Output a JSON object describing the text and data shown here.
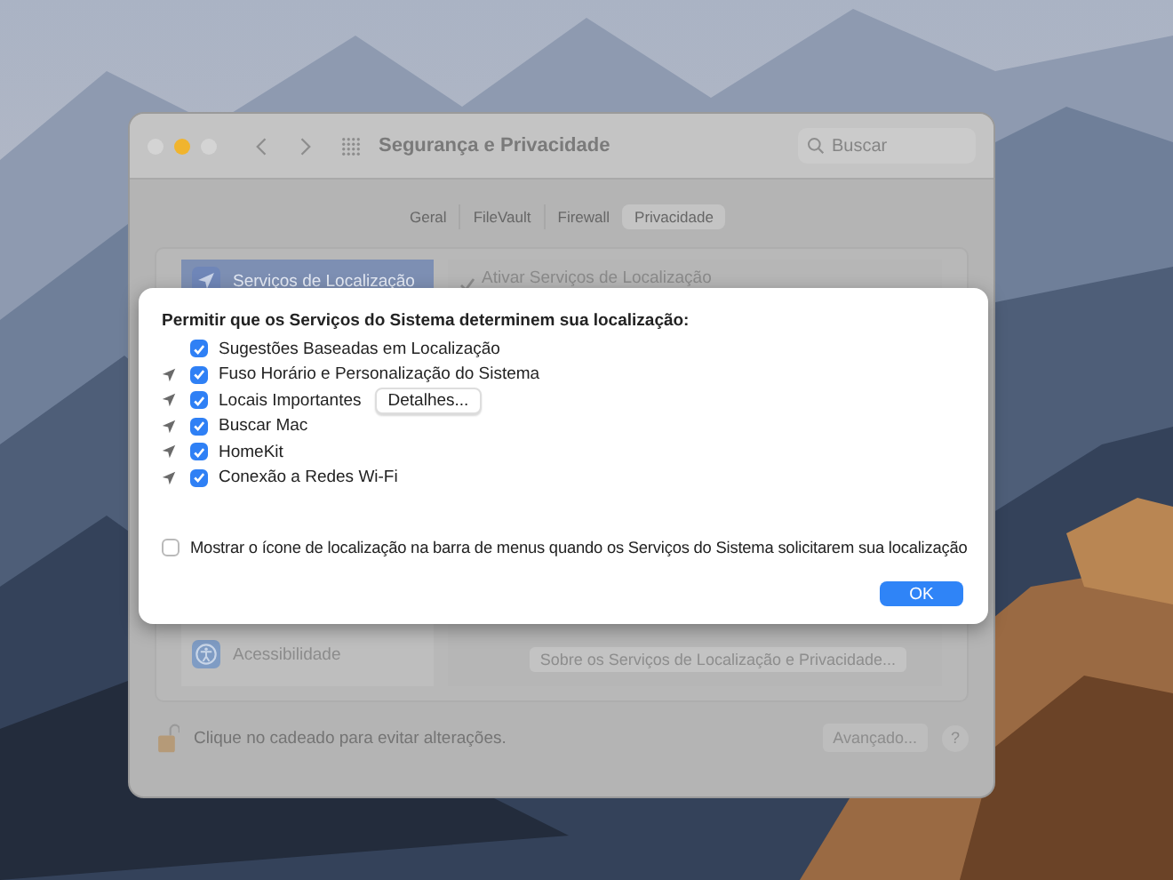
{
  "window": {
    "title": "Segurança e Privacidade",
    "search": {
      "placeholder": "Buscar"
    },
    "tabs": [
      {
        "label": "Geral",
        "selected": false
      },
      {
        "label": "FileVault",
        "selected": false
      },
      {
        "label": "Firewall",
        "selected": false
      },
      {
        "label": "Privacidade",
        "selected": true
      }
    ],
    "sidebar": {
      "items": [
        {
          "label": "Serviços de Localização",
          "kind": "location",
          "selected": true
        },
        {
          "label": "Acessibilidade",
          "kind": "accessibility",
          "selected": false
        }
      ]
    },
    "enable_location": {
      "label": "Ativar Serviços de Localização",
      "checked": true
    },
    "about_button": "Sobre os Serviços de Localização e Privacidade...",
    "footer": {
      "lock_text": "Clique no cadeado para evitar alterações.",
      "advanced_button": "Avançado...",
      "help_button": "?"
    }
  },
  "sheet": {
    "heading": "Permitir que os Serviços do Sistema determinem sua localização:",
    "items": [
      {
        "label": "Sugestões Baseadas em Localização",
        "checked": true,
        "location_arrow": false
      },
      {
        "label": "Fuso Horário e Personalização do Sistema",
        "checked": true,
        "location_arrow": true
      },
      {
        "label": "Locais Importantes",
        "checked": true,
        "location_arrow": true,
        "button": "Detalhes..."
      },
      {
        "label": "Buscar Mac",
        "checked": true,
        "location_arrow": true
      },
      {
        "label": "HomeKit",
        "checked": true,
        "location_arrow": true
      },
      {
        "label": "Conexão a Redes Wi-Fi",
        "checked": true,
        "location_arrow": true
      }
    ],
    "menu_bar_option": {
      "label": "Mostrar o ícone de localização na barra de menus quando os Serviços do Sistema solicitarem sua localização",
      "checked": false
    },
    "ok_button": "OK"
  }
}
